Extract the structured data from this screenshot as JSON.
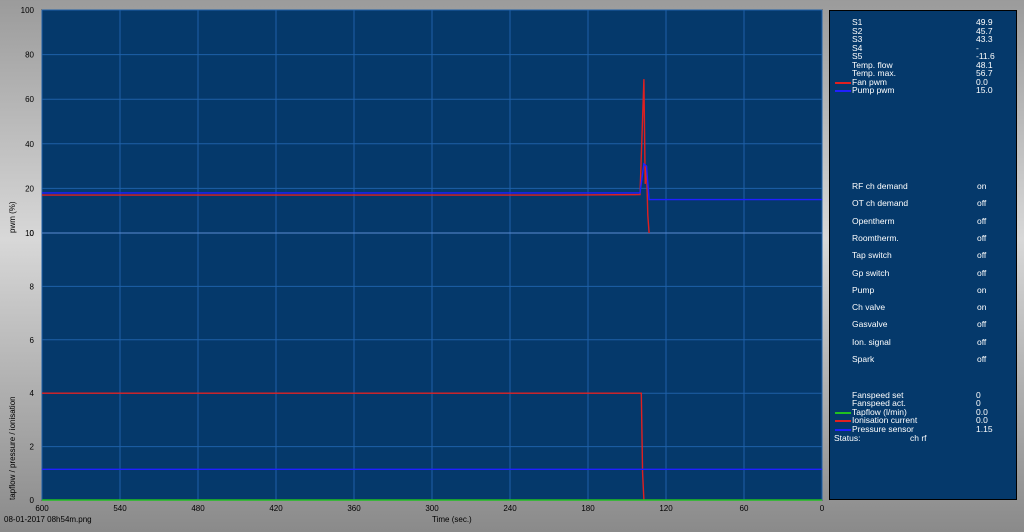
{
  "colors": {
    "plot_bg": "#05396b",
    "grid": "#1e60a8",
    "red": "#e02020",
    "blue": "#2020ff",
    "green": "#20c020"
  },
  "chart_data": [
    {
      "type": "line",
      "ylabel": "pwm (%)",
      "ylim": [
        0,
        100
      ],
      "yticks": [
        0,
        20,
        40,
        60,
        80,
        100
      ],
      "xlim": [
        600,
        0
      ],
      "grid": true,
      "series": [
        {
          "name": "Fan pwm",
          "color": "#e02020",
          "points": [
            [
              600,
              17
            ],
            [
              480,
              17
            ],
            [
              400,
              17
            ],
            [
              300,
              17
            ],
            [
              200,
              17
            ],
            [
              140,
              17.2
            ],
            [
              137,
              69
            ],
            [
              136,
              22
            ],
            [
              135,
              30
            ],
            [
              134,
              8
            ],
            [
              133,
              0
            ]
          ]
        },
        {
          "name": "Pump pwm",
          "color": "#2020ff",
          "points": [
            [
              600,
              18
            ],
            [
              480,
              18
            ],
            [
              400,
              18
            ],
            [
              300,
              18
            ],
            [
              200,
              18
            ],
            [
              140,
              18
            ],
            [
              137,
              31
            ],
            [
              135,
              30
            ],
            [
              133,
              15
            ],
            [
              100,
              15
            ],
            [
              60,
              15
            ],
            [
              0,
              15
            ]
          ]
        }
      ]
    },
    {
      "type": "line",
      "ylabel": "tapflow / pressure / ionisation",
      "xlabel": "Time (sec.)",
      "ylim": [
        0,
        10
      ],
      "yticks": [
        0,
        2,
        4,
        6,
        8,
        10
      ],
      "xlim": [
        600,
        0
      ],
      "xticks": [
        600,
        540,
        480,
        420,
        360,
        300,
        240,
        180,
        120,
        60,
        0
      ],
      "grid": true,
      "series": [
        {
          "name": "Ionisation current",
          "color": "#e02020",
          "points": [
            [
              600,
              4.0
            ],
            [
              500,
              4.0
            ],
            [
              400,
              4.0
            ],
            [
              300,
              4.0
            ],
            [
              200,
              4.0
            ],
            [
              139,
              4.0
            ],
            [
              138,
              1.0
            ],
            [
              137,
              0
            ]
          ]
        },
        {
          "name": "Pressure sensor",
          "color": "#2020ff",
          "points": [
            [
              600,
              1.15
            ],
            [
              300,
              1.15
            ],
            [
              138,
              1.15
            ],
            [
              0,
              1.15
            ]
          ]
        },
        {
          "name": "Tapflow (l/min)",
          "color": "#20c020",
          "points": [
            [
              600,
              0.0
            ],
            [
              0,
              0.0
            ]
          ]
        }
      ]
    }
  ],
  "panel": {
    "sensors": [
      {
        "label": "S1",
        "value": "49.9",
        "color": ""
      },
      {
        "label": "S2",
        "value": "45.7",
        "color": ""
      },
      {
        "label": "S3",
        "value": "43.3",
        "color": ""
      },
      {
        "label": "S4",
        "value": "-",
        "color": ""
      },
      {
        "label": "S5",
        "value": "-11.6",
        "color": ""
      },
      {
        "label": "Temp. flow",
        "value": "48.1",
        "color": ""
      },
      {
        "label": "Temp. max.",
        "value": "56.7",
        "color": ""
      },
      {
        "label": "Fan pwm",
        "value": "0.0",
        "color": "#e02020"
      },
      {
        "label": "Pump pwm",
        "value": "15.0",
        "color": "#2020ff"
      }
    ],
    "digital": [
      {
        "label": "RF ch demand",
        "value": "on"
      },
      {
        "label": "OT ch demand",
        "value": "off"
      },
      {
        "label": "Opentherm",
        "value": "off"
      },
      {
        "label": "Roomtherm.",
        "value": "off"
      },
      {
        "label": "Tap switch",
        "value": "off"
      },
      {
        "label": "Gp switch",
        "value": "off"
      },
      {
        "label": "Pump",
        "value": "on"
      },
      {
        "label": "Ch valve",
        "value": "on"
      },
      {
        "label": "Gasvalve",
        "value": "off"
      },
      {
        "label": "Ion. signal",
        "value": "off"
      },
      {
        "label": "Spark",
        "value": "off"
      }
    ],
    "bottom": [
      {
        "label": "Fanspeed set",
        "value": "0",
        "color": ""
      },
      {
        "label": "Fanspeed act.",
        "value": "0",
        "color": ""
      },
      {
        "label": "Tapflow (l/min)",
        "value": "0.0",
        "color": "#20c020"
      },
      {
        "label": "Ionisation current",
        "value": "0.0",
        "color": "#e02020"
      },
      {
        "label": "Pressure sensor",
        "value": "1.15",
        "color": "#2020ff"
      }
    ],
    "status_label": "Status:",
    "status_value": "ch rf"
  },
  "footer": {
    "filename": "08-01-2017 08h54m.png"
  }
}
